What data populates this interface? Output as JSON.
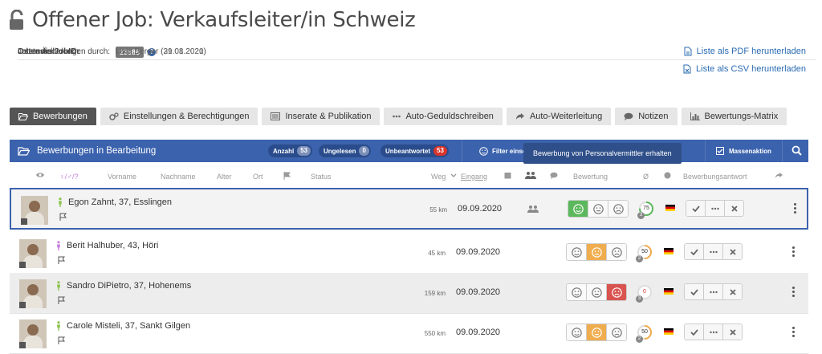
{
  "page": {
    "title": "Offener Job: Verkaufsleiter/in Schweiz"
  },
  "meta": {
    "jobid_label": "Ostendis JobID:",
    "jobid": "23686",
    "help": "?",
    "created_label": "Job erstellt durch:",
    "created_value": "Livia Berger (31.08.2020)",
    "changed_label": "Letzte Änderungen durch:",
    "changed_value": "Livia Berger (29.01.2021)"
  },
  "downloads": {
    "pdf": "Liste als PDF herunterladen",
    "csv": "Liste als CSV herunterladen"
  },
  "tabs": [
    {
      "label": "Bewerbungen",
      "icon": "folder-open-icon"
    },
    {
      "label": "Einstellungen & Berechtigungen",
      "icon": "cogs-icon"
    },
    {
      "label": "Inserate & Publikation",
      "icon": "list-icon"
    },
    {
      "label": "Auto-Geduldschreiben",
      "icon": "ellipsis-icon"
    },
    {
      "label": "Auto-Weiterleitung",
      "icon": "share-icon"
    },
    {
      "label": "Notizen",
      "icon": "comment-icon"
    },
    {
      "label": "Bewertungs-Matrix",
      "icon": "bar-chart-icon"
    }
  ],
  "panel": {
    "title": "Bewerbungen in Bearbeitung",
    "total_label": "Anzahl",
    "total": "53",
    "unread_label": "Ungelesen",
    "unread": "0",
    "unanswered_label": "Unbeantwortet",
    "unanswered": "53",
    "filter_label": "Filter einsch",
    "mass_label": "Massenaktion",
    "tooltip": "Bewerbung von Personalvermittler erhalten"
  },
  "columns": {
    "gender": "♀/♂/?",
    "firstname": "Vorname",
    "lastname": "Nachname",
    "age": "Alter",
    "place": "Ort",
    "status": "Status",
    "distance": "Weg",
    "received": "Eingang",
    "rating": "Bewertung",
    "avg": "Ø",
    "answer": "Bewerbungsantwort"
  },
  "colors": {
    "accent": "#3b62ad",
    "green": "#5cb85c",
    "orange": "#f0ad4e",
    "red": "#d9534f",
    "male": "#8bc34a",
    "female": "#c77ddb"
  },
  "rows": [
    {
      "name": "Egon Zahnt, 37, Esslingen",
      "gender": "male",
      "km": "55 km",
      "date": "09.09.2020",
      "agency": true,
      "rating": "good",
      "score": "75",
      "score_frac": 0.75,
      "score_color": "#5cb85c",
      "count": "3"
    },
    {
      "name": "Berit Halhuber, 43, Höri",
      "gender": "female",
      "km": "45 km",
      "date": "09.09.2020",
      "agency": false,
      "rating": "neutral",
      "score": "50",
      "score_frac": 0.5,
      "score_color": "#f0ad4e",
      "count": "2"
    },
    {
      "name": "Sandro DiPietro, 37, Hohenems",
      "gender": "male",
      "km": "159 km",
      "date": "09.09.2020",
      "agency": false,
      "rating": "bad",
      "score": "0",
      "score_frac": 0,
      "score_color": "#d9534f",
      "count": "3"
    },
    {
      "name": "Carole Misteli, 37, Sankt Gilgen",
      "gender": "male",
      "km": "550 km",
      "date": "09.09.2020",
      "agency": false,
      "rating": "neutral",
      "score": "50",
      "score_frac": 0.5,
      "score_color": "#f0ad4e",
      "count": "2"
    }
  ]
}
